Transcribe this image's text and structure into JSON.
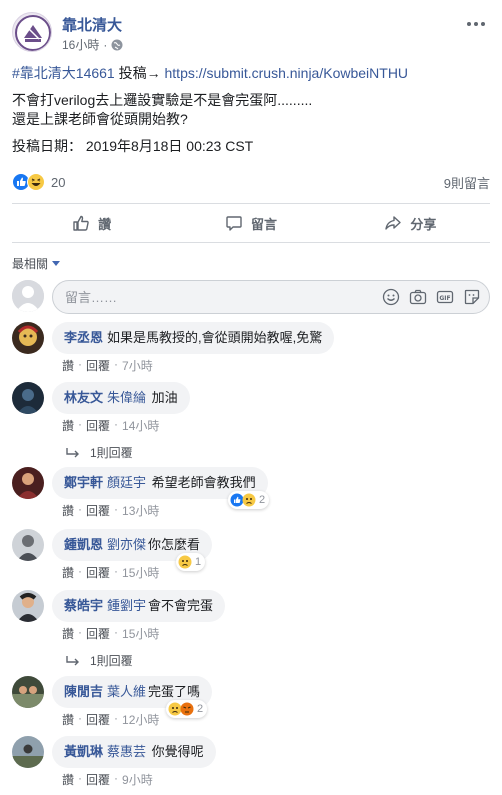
{
  "post": {
    "page_name": "靠北清大",
    "time": "16小時",
    "dot": "·",
    "hashtag": "#靠北清大14661",
    "submit_text": "投稿→",
    "link": "https://submit.crush.ninja/KowbeiNTHU",
    "line1": "不會打verilog去上邏設實驗是不是會完蛋阿.........",
    "line2": "還是上課老師會從頭開始教?",
    "date_line": "投稿日期： 2019年8月18日 00:23 CST",
    "reaction_count": "20",
    "comment_count": "9則留言"
  },
  "actions": {
    "like": "讚",
    "comment": "留言",
    "share": "分享"
  },
  "filter": {
    "label": "最相關"
  },
  "composer": {
    "placeholder": "留言……"
  },
  "comments": [
    {
      "author": "李丞恩",
      "mention": "",
      "text": "如果是馬教授的,會從頭開始教喔,免驚",
      "like": "讚",
      "reply": "回覆",
      "time": "7小時"
    },
    {
      "author": "林友文",
      "mention": "朱偉綸",
      "text": "加油",
      "like": "讚",
      "reply": "回覆",
      "time": "14小時",
      "replies": "1則回覆"
    },
    {
      "author": "鄭宇軒",
      "mention": "顏廷宇",
      "text": "希望老師會教我們",
      "like": "讚",
      "reply": "回覆",
      "time": "13小時",
      "react_count": "2"
    },
    {
      "author": "鍾凱恩",
      "mention": "劉亦傑",
      "text": "你怎麼看",
      "like": "讚",
      "reply": "回覆",
      "time": "15小時",
      "react_count": "1"
    },
    {
      "author": "蔡皓宇",
      "mention": "鍾劉宇",
      "text": "會不會完蛋",
      "like": "讚",
      "reply": "回覆",
      "time": "15小時",
      "replies": "1則回覆"
    },
    {
      "author": "陳閒吉",
      "mention": "葉人維",
      "text": "完蛋了嗎",
      "like": "讚",
      "reply": "回覆",
      "time": "12小時",
      "react_count": "2"
    },
    {
      "author": "黃凱琳",
      "mention": "蔡惠芸",
      "text": "你覺得呢",
      "like": "讚",
      "reply": "回覆",
      "time": "9小時"
    }
  ],
  "colors": {
    "link": "#385898",
    "like_blue": "#1877f2",
    "haha_yellow": "#f7c944",
    "angry_orange": "#e9710f"
  }
}
